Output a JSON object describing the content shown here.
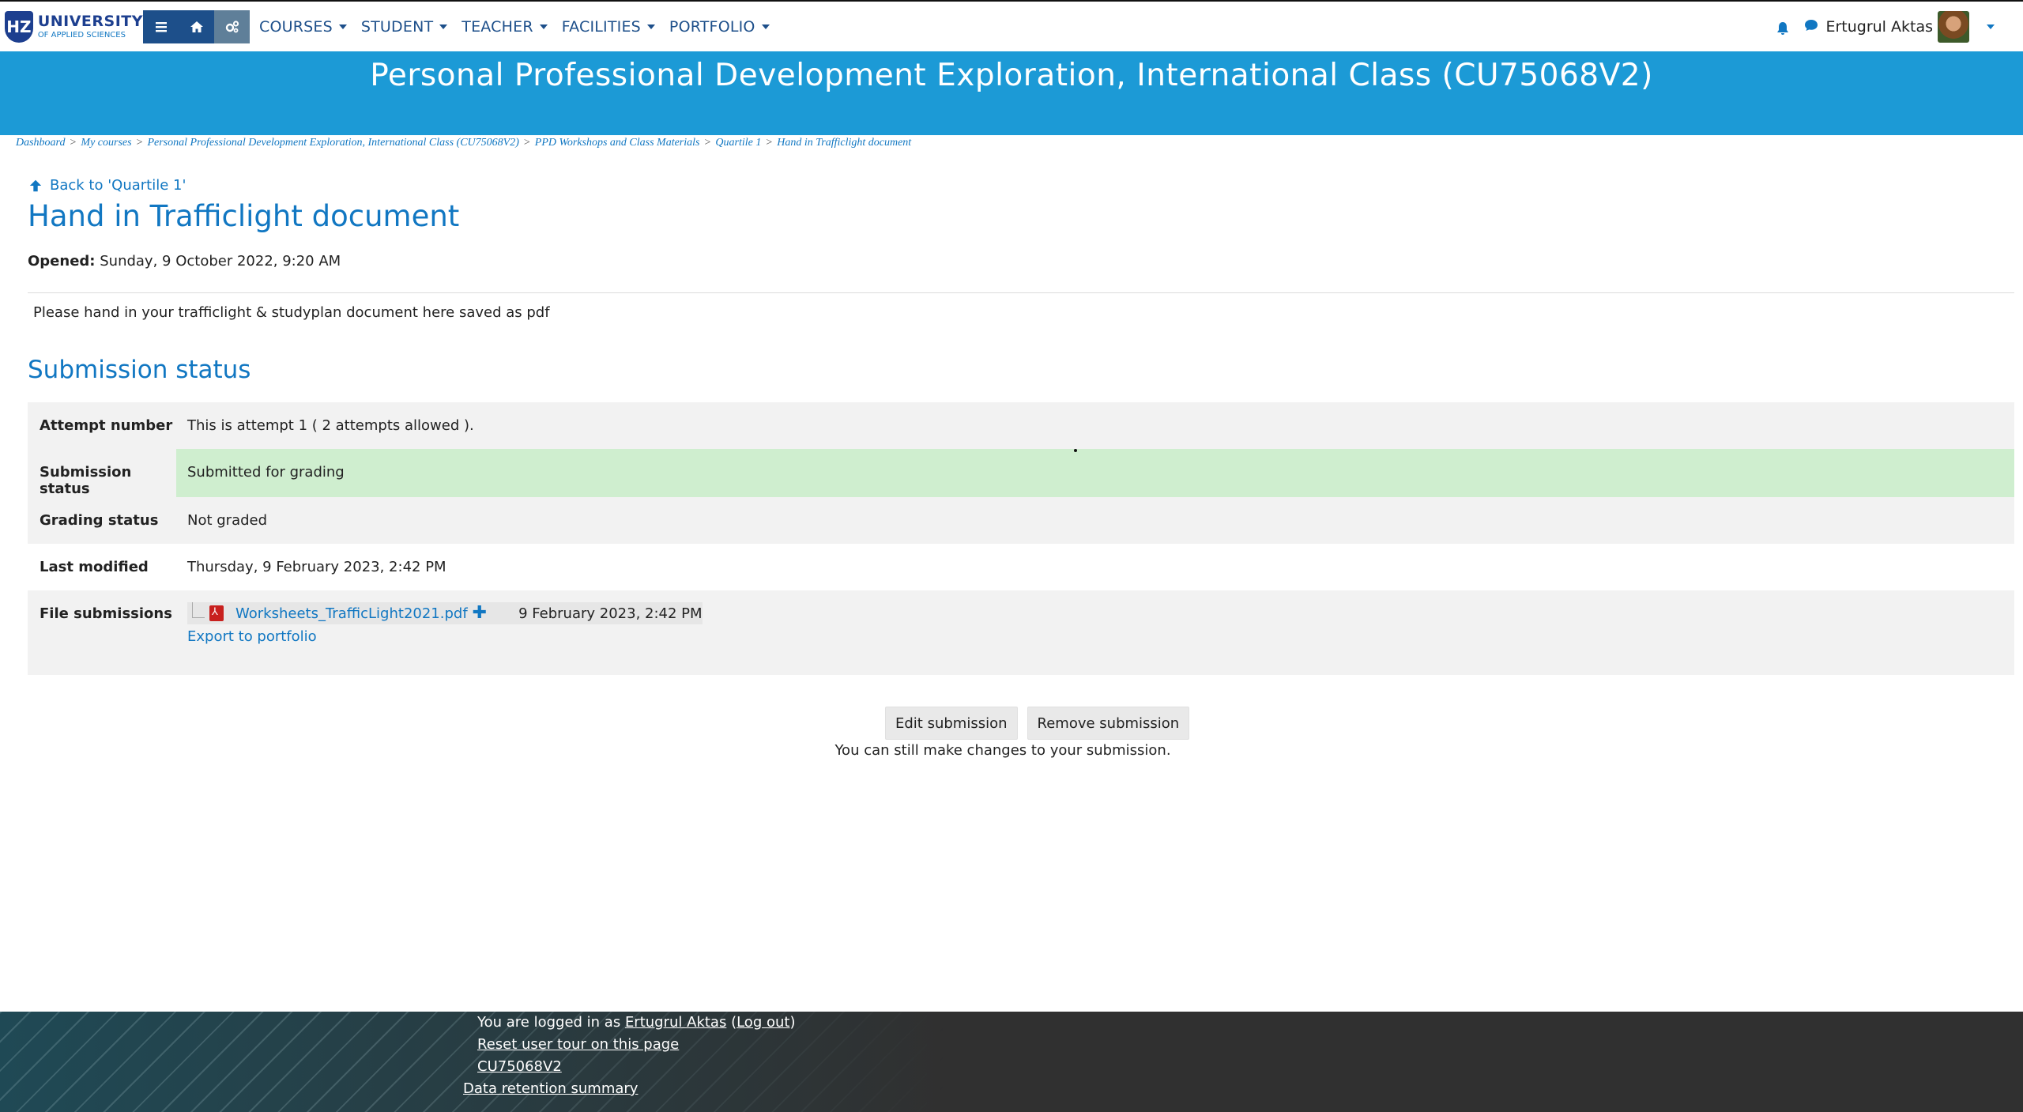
{
  "nav": {
    "logo_line1": "UNIVERSITY",
    "logo_line2": "OF APPLIED SCIENCES",
    "logo_badge": "HZ",
    "menu": [
      {
        "label": "COURSES"
      },
      {
        "label": "STUDENT"
      },
      {
        "label": "TEACHER"
      },
      {
        "label": "FACILITIES"
      },
      {
        "label": "PORTFOLIO"
      }
    ],
    "user_name": "Ertugrul Aktas",
    "icons": [
      "hamburger-icon",
      "home-icon",
      "cogs-icon",
      "bell-icon",
      "chat-icon"
    ]
  },
  "banner": {
    "course_title": "Personal Professional Development Exploration, International Class (CU75068V2)"
  },
  "breadcrumb": [
    "Dashboard",
    "My courses",
    "Personal Professional Development Exploration, International Class (CU75068V2)",
    "PPD Workshops and Class Materials",
    "Quartile 1",
    "Hand in Trafficlight document"
  ],
  "breadcrumb_sep": ">",
  "back_link": "Back to 'Quartile 1'",
  "page_title": "Hand in Trafficlight document",
  "opened_label": "Opened:",
  "opened_value": "Sunday, 9 October 2022, 9:20 AM",
  "intro": "Please hand in your trafficlight & studyplan document here saved as pdf",
  "section_title": "Submission status",
  "status": {
    "attempt_label": "Attempt number",
    "attempt_value": "This is attempt 1 ( 2 attempts allowed ).",
    "submission_label": "Submission status",
    "submission_value": "Submitted for grading",
    "grading_label": "Grading status",
    "grading_value": "Not graded",
    "modified_label": "Last modified",
    "modified_value": "Thursday, 9 February 2023, 2:42 PM",
    "files_label": "File submissions",
    "file_name": "Worksheets_TrafficLight2021.pdf",
    "file_plus": "✚",
    "file_date": "9 February 2023, 2:42 PM",
    "export_link": "Export to portfolio"
  },
  "buttons": {
    "edit": "Edit submission",
    "remove": "Remove submission",
    "note": "You can still make changes to your submission."
  },
  "footer": {
    "logged_in_prefix": "You are logged in as ",
    "user_link": "Ertugrul Aktas",
    "logout_link": "Log out",
    "reset_tour": "Reset user tour on this page",
    "course_code": "CU75068V2",
    "data_retention": "Data retention summary"
  },
  "colors": {
    "accent": "#1177c2",
    "banner": "#1c9ad6",
    "nav_dark": "#1d4f8a",
    "submitted_bg": "#cfeecf",
    "footer_bg": "#303030"
  }
}
